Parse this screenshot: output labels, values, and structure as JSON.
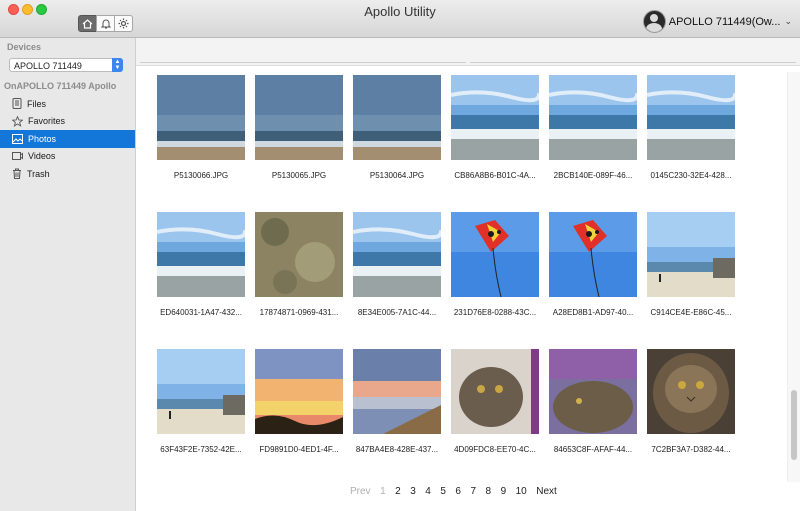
{
  "window": {
    "title": "Apollo Utility"
  },
  "toolbar": {
    "buttons": [
      "home-icon",
      "bell-icon",
      "gear-icon"
    ]
  },
  "account": {
    "name": "APOLLO 711449(Ow..."
  },
  "sidebar": {
    "devices_header": "Devices",
    "device_select": "APOLLO 711449",
    "device_section": "OnAPOLLO 711449 Apollo",
    "items": [
      {
        "label": "Files",
        "icon": "files-icon"
      },
      {
        "label": "Favorites",
        "icon": "star-icon"
      },
      {
        "label": "Photos",
        "icon": "photos-icon"
      },
      {
        "label": "Videos",
        "icon": "videos-icon"
      },
      {
        "label": "Trash",
        "icon": "trash-icon"
      }
    ],
    "selected": "Photos"
  },
  "photos": [
    {
      "name": "P5130066.JPG",
      "kind": "beach-cloudy"
    },
    {
      "name": "P5130065.JPG",
      "kind": "beach-cloudy"
    },
    {
      "name": "P5130064.JPG",
      "kind": "beach-cloudy"
    },
    {
      "name": "CB86A8B6-B01C-4A...",
      "kind": "beach-waves"
    },
    {
      "name": "2BCB140E-089F-46...",
      "kind": "beach-waves"
    },
    {
      "name": "0145C230-32E4-428...",
      "kind": "beach-waves"
    },
    {
      "name": "ED640031-1A47-432...",
      "kind": "beach-waves"
    },
    {
      "name": "17874871-0969-431...",
      "kind": "sand-grass"
    },
    {
      "name": "8E34E005-7A1C-44...",
      "kind": "beach-waves"
    },
    {
      "name": "231D76E8-0288-43C...",
      "kind": "kite"
    },
    {
      "name": "A28ED8B1-AD97-40...",
      "kind": "kite"
    },
    {
      "name": "C914CE4E-E86C-45...",
      "kind": "beach-people"
    },
    {
      "name": "63F43F2E-7352-42E...",
      "kind": "beach-people"
    },
    {
      "name": "FD9891D0-4ED1-4F...",
      "kind": "sunset"
    },
    {
      "name": "847BA4E8-428E-437...",
      "kind": "sunset-boardwalk"
    },
    {
      "name": "4D09FDC8-EE70-4C...",
      "kind": "cat"
    },
    {
      "name": "84653C8F-AFAF-44...",
      "kind": "cat-blanket"
    },
    {
      "name": "7C2BF3A7-D382-44...",
      "kind": "cat-face"
    }
  ],
  "pagination": {
    "prev": "Prev",
    "pages": [
      "1",
      "2",
      "3",
      "4",
      "5",
      "6",
      "7",
      "8",
      "9",
      "10"
    ],
    "current": "1",
    "next": "Next"
  }
}
